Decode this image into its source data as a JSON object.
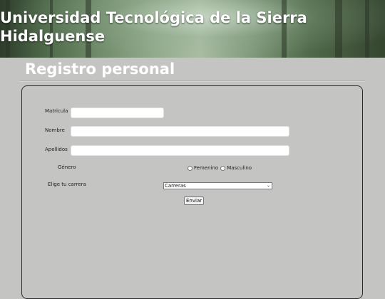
{
  "header": {
    "title": "Universidad Tecnológica de la Sierra Hidalguense"
  },
  "page": {
    "heading": "Registro personal"
  },
  "form": {
    "matricula_label": "Matricula",
    "nombre_label": "Nombre",
    "apellidos_label": "Apellidos",
    "genero_label": "Género",
    "genero_options": [
      "Femenino",
      "Masculino"
    ],
    "carrera_label": "Elige tu carrera",
    "carrera_selected": "Carreras",
    "submit_label": "Enviar"
  },
  "colors": {
    "background": "#c4c4c2",
    "heading_text": "#ffffff",
    "panel_border": "#2a2a2a"
  }
}
